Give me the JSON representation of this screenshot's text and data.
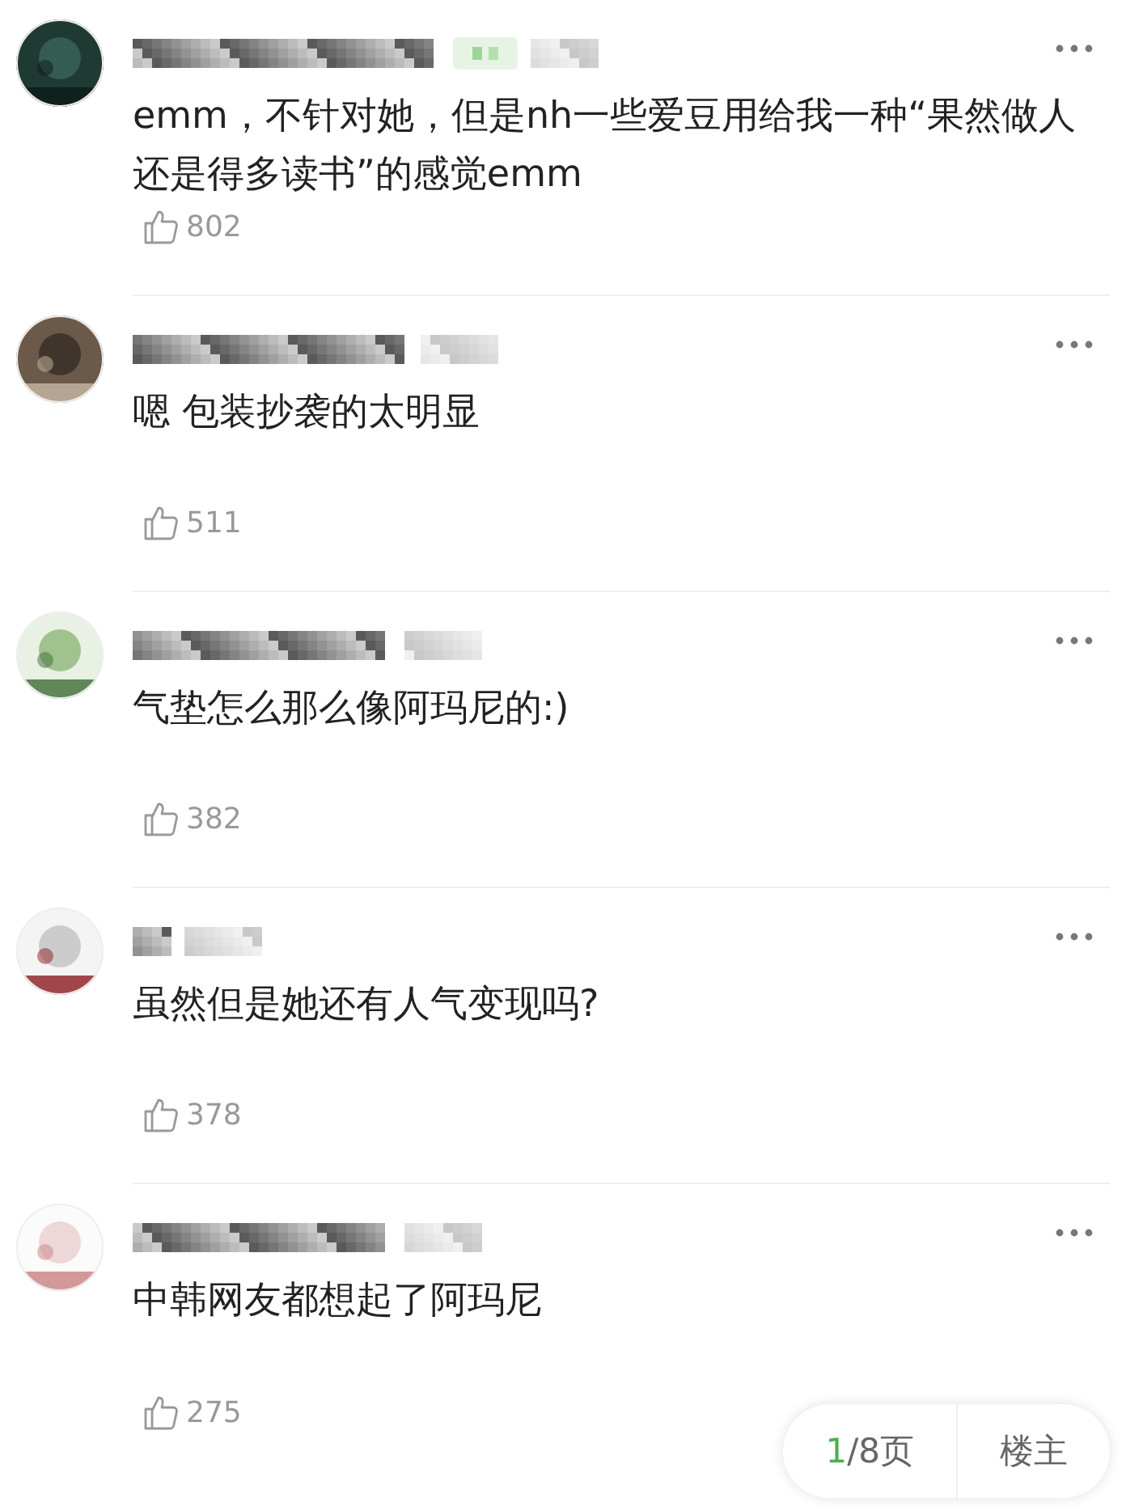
{
  "comments": [
    {
      "has_badge": true,
      "text": "emm，不针对她，但是nh一些爱豆用给我一种“果然做人还是得多读书”的感觉emm",
      "likes": "802"
    },
    {
      "has_badge": false,
      "text": "嗯 包装抄袭的太明显",
      "likes": "511"
    },
    {
      "has_badge": false,
      "text": "气垫怎么那么像阿玛尼的:)",
      "likes": "382"
    },
    {
      "has_badge": false,
      "text": "虽然但是她还有人气变现吗?",
      "likes": "378"
    },
    {
      "has_badge": false,
      "text": "中韩网友都想起了阿玛尼",
      "likes": "275"
    }
  ],
  "pager": {
    "current": "1",
    "total": "/8页"
  },
  "author_button": "楼主"
}
